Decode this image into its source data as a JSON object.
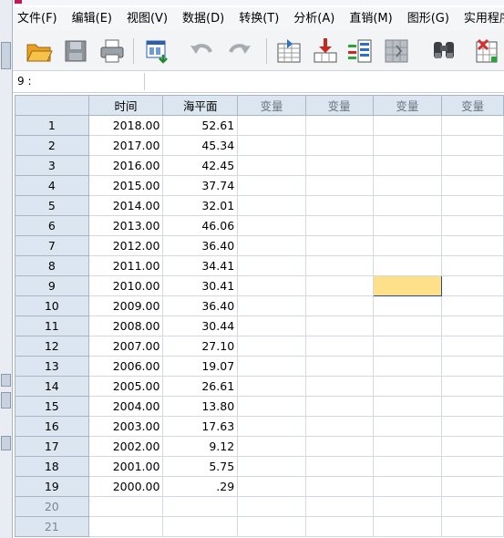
{
  "menu": [
    "文件(F)",
    "编辑(E)",
    "视图(V)",
    "数据(D)",
    "转换(T)",
    "分析(A)",
    "直销(M)",
    "图形(G)",
    "实用程序("
  ],
  "toolbar": {
    "icons": [
      "open-folder-icon",
      "save-icon",
      "print-icon",
      "dialog-recall-icon",
      "undo-icon",
      "redo-icon",
      "goto-case-icon",
      "goto-variable-icon",
      "variables-icon",
      "run-descriptives-icon",
      "find-icon",
      "insert-cases-icon"
    ]
  },
  "cell_reference": "9 :",
  "grid": {
    "columns": [
      "时间",
      "海平面",
      "变量",
      "变量",
      "变量",
      "变量"
    ],
    "rows": [
      {
        "n": "1",
        "year": "2018.00",
        "sea": "52.61"
      },
      {
        "n": "2",
        "year": "2017.00",
        "sea": "45.34"
      },
      {
        "n": "3",
        "year": "2016.00",
        "sea": "42.45"
      },
      {
        "n": "4",
        "year": "2015.00",
        "sea": "37.74"
      },
      {
        "n": "5",
        "year": "2014.00",
        "sea": "32.01"
      },
      {
        "n": "6",
        "year": "2013.00",
        "sea": "46.06"
      },
      {
        "n": "7",
        "year": "2012.00",
        "sea": "36.40"
      },
      {
        "n": "8",
        "year": "2011.00",
        "sea": "34.41"
      },
      {
        "n": "9",
        "year": "2010.00",
        "sea": "30.41"
      },
      {
        "n": "10",
        "year": "2009.00",
        "sea": "36.40"
      },
      {
        "n": "11",
        "year": "2008.00",
        "sea": "30.44"
      },
      {
        "n": "12",
        "year": "2007.00",
        "sea": "27.10"
      },
      {
        "n": "13",
        "year": "2006.00",
        "sea": "19.07"
      },
      {
        "n": "14",
        "year": "2005.00",
        "sea": "26.61"
      },
      {
        "n": "15",
        "year": "2004.00",
        "sea": "13.80"
      },
      {
        "n": "16",
        "year": "2003.00",
        "sea": "17.63"
      },
      {
        "n": "17",
        "year": "2002.00",
        "sea": "9.12"
      },
      {
        "n": "18",
        "year": "2001.00",
        "sea": "5.75"
      },
      {
        "n": "19",
        "year": "2000.00",
        "sea": ".29"
      },
      {
        "n": "20",
        "year": "",
        "sea": ""
      },
      {
        "n": "21",
        "year": "",
        "sea": ""
      }
    ]
  },
  "colors": {
    "header_bg": "#dbe6f1",
    "selected_cell": "#ffe08a",
    "selected_border": "#1f4b9e"
  }
}
